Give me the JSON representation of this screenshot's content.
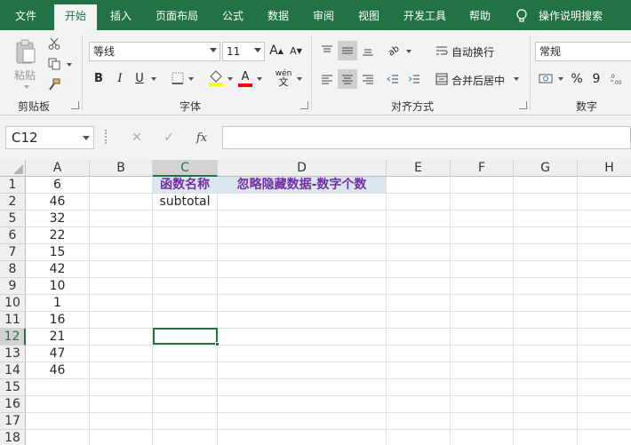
{
  "ribbon": {
    "tabs": [
      "文件",
      "开始",
      "插入",
      "页面布局",
      "公式",
      "数据",
      "审阅",
      "视图",
      "开发工具",
      "帮助"
    ],
    "active_tab": "开始",
    "tell_me": "操作说明搜索",
    "clipboard": {
      "paste_label": "粘贴",
      "group_label": "剪贴板"
    },
    "font": {
      "name": "等线",
      "size": "11",
      "group_label": "字体",
      "bold": "B",
      "italic": "I",
      "underline": "U",
      "grow": "A",
      "shrink": "A",
      "font_color_letter": "A"
    },
    "alignment": {
      "wrap_text": "自动换行",
      "merge_center": "合并后居中",
      "group_label": "对齐方式",
      "wen": "wén",
      "orient": "ab"
    },
    "number": {
      "format": "常规",
      "group_label": "数字",
      "percent": "%",
      "comma": "9"
    },
    "colors": {
      "brand": "#217346",
      "fill_swatch": "#ffff00",
      "font_swatch": "#ff0000"
    }
  },
  "formula_bar": {
    "name_box": "C12",
    "fx_label": "fx",
    "cancel": "✕",
    "enter": "✓",
    "content": ""
  },
  "sheet": {
    "columns": [
      "A",
      "B",
      "C",
      "D",
      "E",
      "F",
      "G",
      "H"
    ],
    "selected_column": "C",
    "rows": [
      "1",
      "2",
      "5",
      "6",
      "7",
      "8",
      "9",
      "10",
      "11",
      "12",
      "13",
      "14",
      "15",
      "16",
      "17",
      "18"
    ],
    "selected_row": "12",
    "col_a": [
      "6",
      "46",
      "32",
      "22",
      "15",
      "42",
      "10",
      "1",
      "16",
      "21",
      "47",
      "46",
      "",
      "",
      "",
      ""
    ],
    "c1": "函数名称",
    "d1": "忽略隐藏数据-数字个数",
    "c2": "subtotal"
  }
}
